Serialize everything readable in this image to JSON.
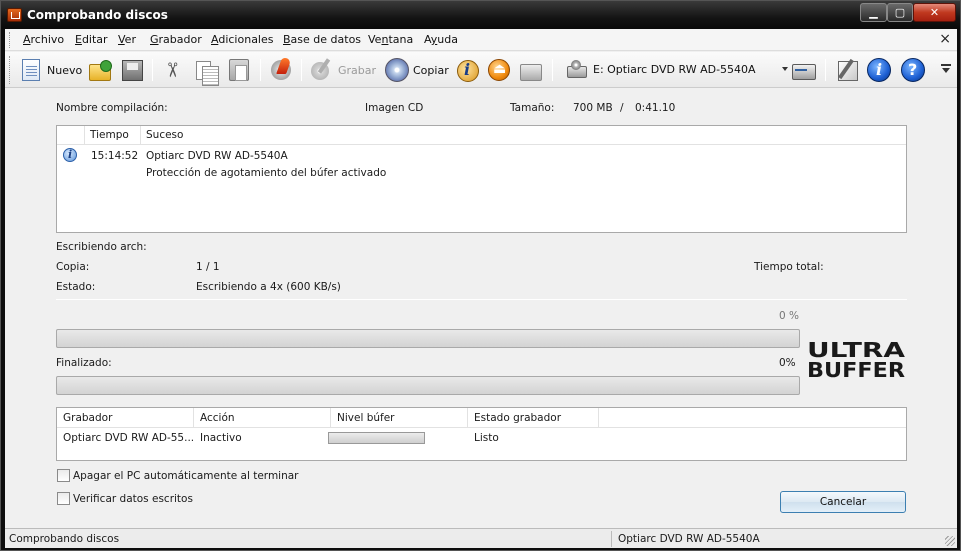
{
  "window": {
    "title": "Comprobando discos"
  },
  "menu": {
    "items": [
      {
        "pre": "",
        "u": "A",
        "post": "rchivo"
      },
      {
        "pre": "",
        "u": "E",
        "post": "ditar"
      },
      {
        "pre": "",
        "u": "V",
        "post": "er"
      },
      {
        "pre": "",
        "u": "G",
        "post": "rabador"
      },
      {
        "pre": "",
        "u": "A",
        "post": "dicionales"
      },
      {
        "pre": "",
        "u": "B",
        "post": "ase de datos"
      },
      {
        "pre": "Ve",
        "u": "n",
        "post": "tana"
      },
      {
        "pre": "A",
        "u": "y",
        "post": "uda"
      }
    ],
    "close": "×"
  },
  "toolbar": {
    "nuevo": "Nuevo",
    "grabar": "Grabar",
    "copiar": "Copiar",
    "drive": "E: Optiarc DVD RW AD-5540A"
  },
  "summary": {
    "compilation_label": "Nombre compilación:",
    "type": "Imagen CD",
    "size_label": "Tamaño:",
    "size_value": "700 MB",
    "size_sep": "/",
    "duration": "0:41.10"
  },
  "log": {
    "col_time": "Tiempo",
    "col_event": "Suceso",
    "rows": [
      {
        "time": "15:14:52",
        "event": "Optiarc DVD RW AD-5540A"
      },
      {
        "time": "",
        "event": "Protección de agotamiento del búfer activado"
      }
    ]
  },
  "status": {
    "writing_file_label": "Escribiendo arch:",
    "copy_label": "Copia:",
    "copy_value": "1 / 1",
    "total_time_label": "Tiempo total:",
    "state_label": "Estado:",
    "state_value": "Escribiendo a 4x (600 KB/s)"
  },
  "progress": {
    "track_percent_text": "0 %",
    "track_percent": 0,
    "finalized_label": "Finalizado:",
    "finalized_percent_text": "0%",
    "finalized_percent": 0
  },
  "logo": {
    "line1": "ULTRA",
    "line2": "BUFFER"
  },
  "drives_table": {
    "headers": [
      "Grabador",
      "Acción",
      "Nivel búfer",
      "Estado grabador"
    ],
    "rows": [
      {
        "recorder": "Optiarc DVD RW AD-55...",
        "action": "Inactivo",
        "buffer_level": 0,
        "state": "Listo"
      }
    ]
  },
  "options": {
    "shutdown": "Apagar el PC automáticamente al terminar",
    "verify": "Verificar datos escritos"
  },
  "buttons": {
    "cancel": "Cancelar"
  },
  "statusbar": {
    "left": "Comprobando discos",
    "right": "Optiarc  DVD RW AD-5540A"
  },
  "colors": {
    "progress_fill": "#2fb52a",
    "titlebar": "#141414",
    "button_border": "#3c7fb1"
  }
}
